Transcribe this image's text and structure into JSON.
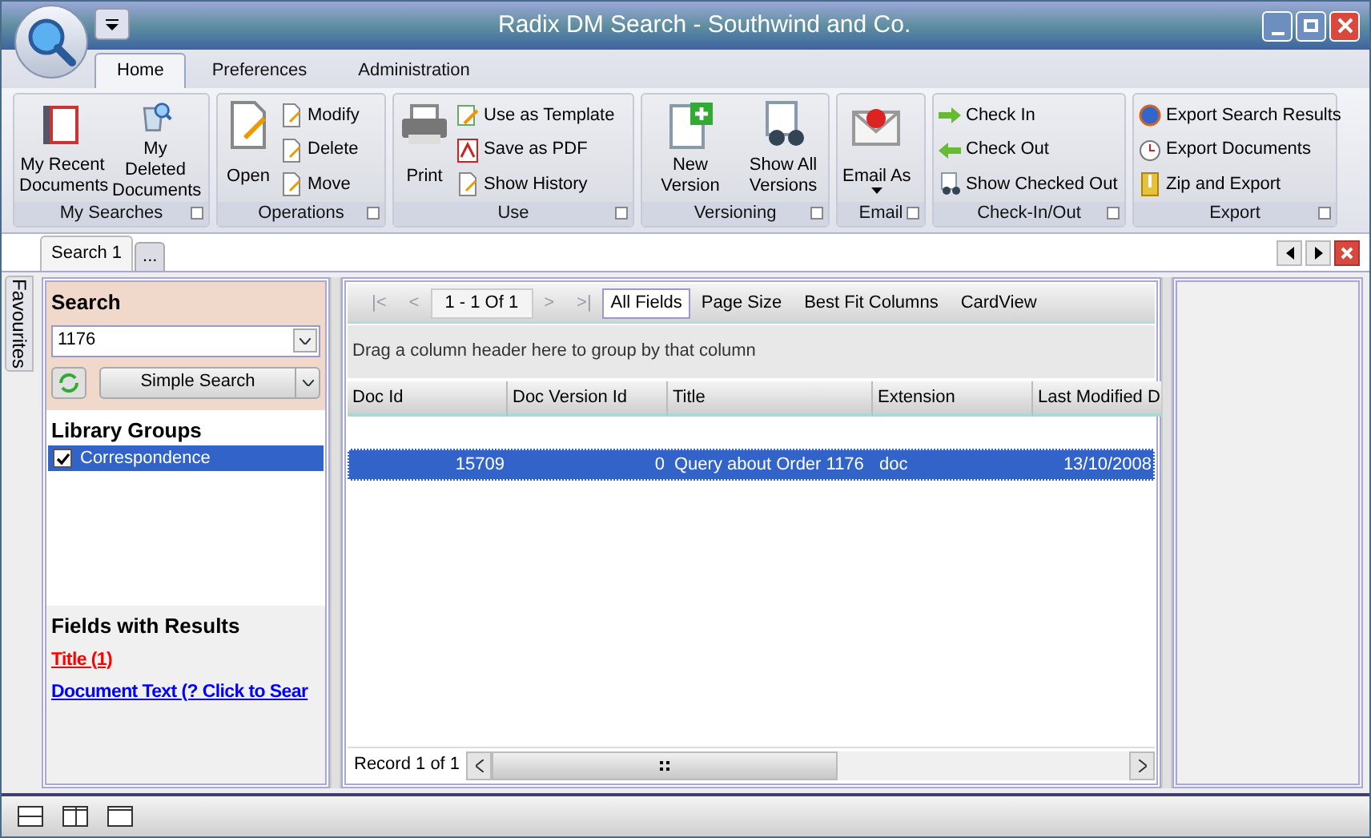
{
  "window": {
    "title": "Radix DM Search - Southwind and Co."
  },
  "ribbon_tabs": [
    {
      "label": "Home",
      "selected": true
    },
    {
      "label": "Preferences",
      "selected": false
    },
    {
      "label": "Administration",
      "selected": false
    }
  ],
  "ribbon_groups": [
    {
      "caption": "My Searches",
      "items": [
        {
          "label": "My Recent Documents",
          "kind": "large"
        },
        {
          "label": "My Deleted Documents",
          "kind": "large"
        }
      ]
    },
    {
      "caption": "Operations",
      "items": [
        {
          "label": "Open",
          "kind": "large"
        },
        {
          "label": "Modify",
          "kind": "small"
        },
        {
          "label": "Delete",
          "kind": "small"
        },
        {
          "label": "Move",
          "kind": "small"
        }
      ]
    },
    {
      "caption": "Use",
      "items": [
        {
          "label": "Print",
          "kind": "large"
        },
        {
          "label": "Use as Template",
          "kind": "small"
        },
        {
          "label": "Save as PDF",
          "kind": "small"
        },
        {
          "label": "Show History",
          "kind": "small"
        }
      ]
    },
    {
      "caption": "Versioning",
      "items": [
        {
          "label": "New Version",
          "kind": "large"
        },
        {
          "label": "Show All Versions",
          "kind": "large"
        }
      ]
    },
    {
      "caption": "Email",
      "items": [
        {
          "label": "Email As",
          "kind": "large",
          "dropdown": true
        }
      ]
    },
    {
      "caption": "Check-In/Out",
      "items": [
        {
          "label": "Check In",
          "kind": "small"
        },
        {
          "label": "Check Out",
          "kind": "small"
        },
        {
          "label": "Show Checked Out",
          "kind": "small"
        }
      ]
    },
    {
      "caption": "Export",
      "items": [
        {
          "label": "Export Search Results",
          "kind": "small"
        },
        {
          "label": "Export Documents",
          "kind": "small"
        },
        {
          "label": "Zip and Export",
          "kind": "small"
        }
      ]
    }
  ],
  "doc_tabs": [
    {
      "label": "Search 1",
      "selected": true
    },
    {
      "label": "...",
      "selected": false
    }
  ],
  "side_tab": {
    "label": "Favourites"
  },
  "search_panel": {
    "heading": "Search",
    "value": "1176",
    "mode_button": "Simple Search"
  },
  "library_groups": {
    "heading": "Library Groups",
    "items": [
      {
        "label": "Correspondence",
        "checked": true,
        "selected": true
      }
    ]
  },
  "fields_with_results": {
    "heading": "Fields with Results",
    "links": [
      {
        "label": "Title (1)",
        "color": "#ff0000"
      },
      {
        "label": "Document Text (? Click to Sear",
        "color": "#0000ff"
      }
    ]
  },
  "grid_toolbar": {
    "pager": [
      {
        "label": "|<",
        "disabled": true
      },
      {
        "label": "<",
        "disabled": true
      }
    ],
    "page_info": "1 - 1 Of 1",
    "pager_next": [
      {
        "label": ">",
        "disabled": true
      },
      {
        "label": ">|",
        "disabled": true
      }
    ],
    "buttons": [
      {
        "label": "All Fields",
        "selected": true
      },
      {
        "label": "Page Size",
        "selected": false
      },
      {
        "label": "Best Fit Columns",
        "selected": false
      },
      {
        "label": "CardView",
        "selected": false
      }
    ]
  },
  "group_hint": "Drag a column header here to group by that column",
  "table": {
    "columns": [
      {
        "label": "Doc Id"
      },
      {
        "label": "Doc Version Id"
      },
      {
        "label": "Title"
      },
      {
        "label": "Extension"
      },
      {
        "label": "Last Modified D"
      }
    ],
    "rows": [
      {
        "cells": [
          "15709",
          "0",
          "Query about Order 1176",
          "doc",
          "13/10/2008"
        ],
        "selected": true
      }
    ]
  },
  "record_info": "Record 1 of 1"
}
